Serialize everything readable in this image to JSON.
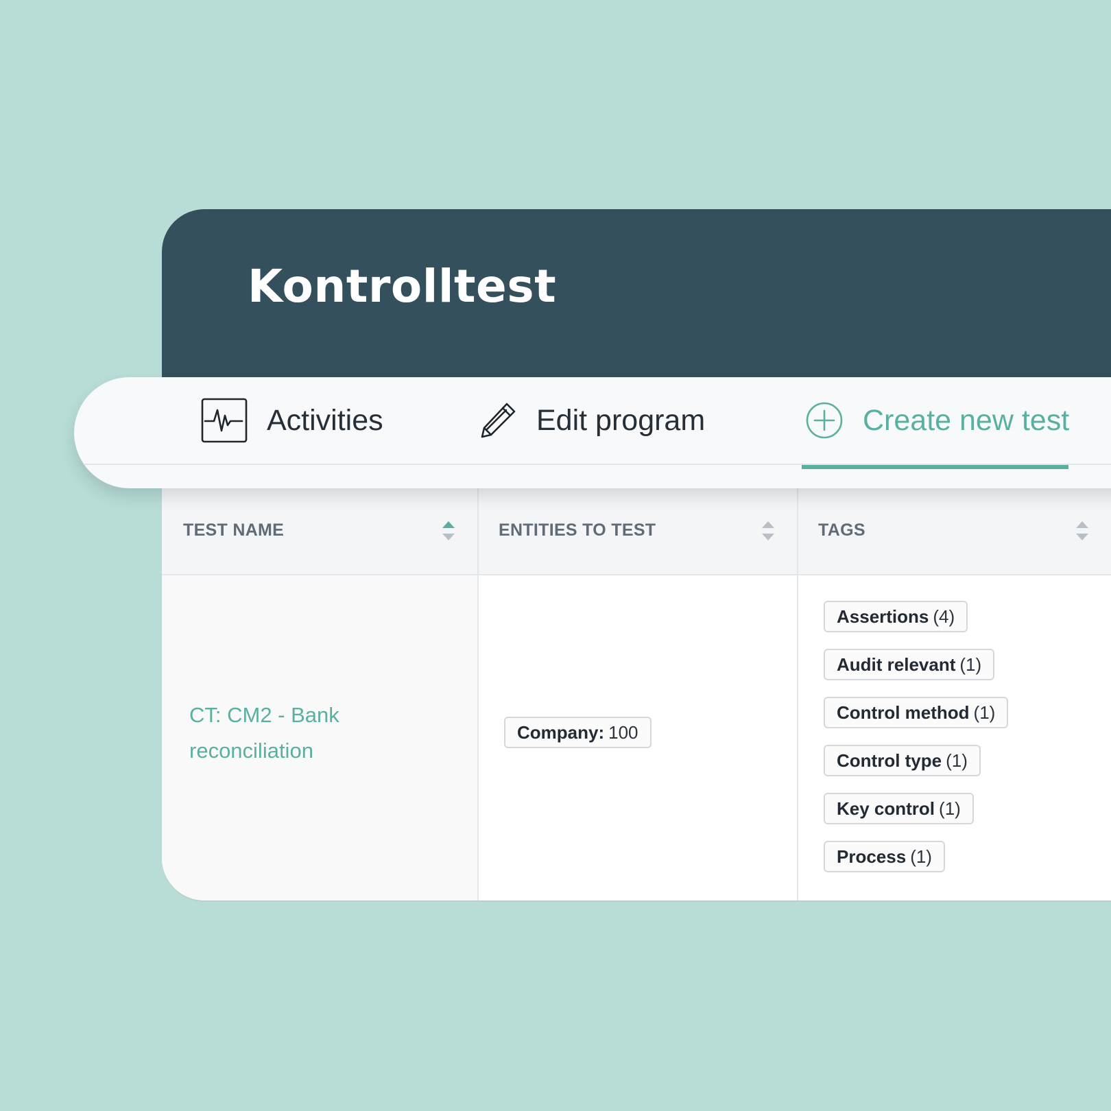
{
  "page": {
    "title": "Kontrolltest"
  },
  "toolbar": {
    "activities_label": "Activities",
    "edit_label": "Edit program",
    "create_label": "Create new test"
  },
  "table": {
    "columns": [
      "TEST NAME",
      "ENTITIES TO TEST",
      "TAGS"
    ],
    "row": {
      "test_name": "CT: CM2 - Bank reconciliation",
      "entity": {
        "label": "Company:",
        "value": "100"
      },
      "tags": [
        {
          "name": "Assertions",
          "count": "(4)"
        },
        {
          "name": "Audit relevant",
          "count": "(1)"
        },
        {
          "name": "Control method",
          "count": "(1)"
        },
        {
          "name": "Control type",
          "count": "(1)"
        },
        {
          "name": "Key control",
          "count": "(1)"
        },
        {
          "name": "Process",
          "count": "(1)"
        }
      ]
    }
  },
  "colors": {
    "background": "#b8dcd6",
    "header": "#34505c",
    "accent": "#5ab0a0"
  },
  "icons": [
    "activity-pulse-icon",
    "pencil-icon",
    "plus-circle-icon",
    "sort-icon"
  ]
}
